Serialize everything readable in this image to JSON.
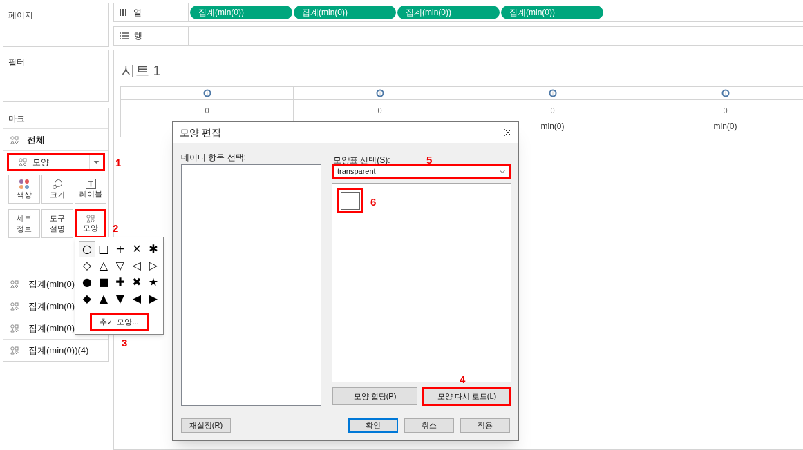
{
  "pages_card": {
    "title": "페이지"
  },
  "filters_card": {
    "title": "필터"
  },
  "marks": {
    "title": "마크",
    "all_label": "전체",
    "mark_type": {
      "value": "모양",
      "highlighted": true,
      "callout": "1"
    },
    "properties": [
      {
        "lines": [
          "색상"
        ],
        "kind": "color",
        "highlighted": false
      },
      {
        "lines": [
          "크기"
        ],
        "kind": "size",
        "highlighted": false
      },
      {
        "lines": [
          "레이블"
        ],
        "kind": "label",
        "highlighted": false
      },
      {
        "lines": [
          "세부",
          "정보"
        ],
        "kind": "text",
        "highlighted": false
      },
      {
        "lines": [
          "도구",
          "설명"
        ],
        "kind": "text",
        "highlighted": false
      },
      {
        "lines": [
          "모양"
        ],
        "kind": "shape",
        "highlighted": true,
        "callout": "2"
      }
    ],
    "layers": [
      {
        "label": "집계(min(0)"
      },
      {
        "label": "집계(min(0)"
      },
      {
        "label": "집계(min(0)"
      },
      {
        "label": "집계(min(0))(4)"
      }
    ]
  },
  "shelves": [
    {
      "label": "열",
      "kind": "columns",
      "pills": [
        "집계(min(0))",
        "집계(min(0))",
        "집계(min(0))",
        "집계(min(0))"
      ]
    },
    {
      "label": "행",
      "kind": "rows"
    }
  ],
  "sheet": {
    "title": "시트 1",
    "columns": [
      {
        "axis_value": "0"
      },
      {
        "axis_value": "0"
      },
      {
        "axis_value": "0",
        "field_label": "min(0)"
      },
      {
        "axis_value": "0",
        "field_label": "min(0)"
      }
    ]
  },
  "shape_menu": {
    "shapes": [
      {
        "symbol": "○",
        "selected": true
      },
      {
        "symbol": "□",
        "selected": false
      },
      {
        "symbol": "+",
        "selected": false
      },
      {
        "symbol": "✕",
        "selected": false
      },
      {
        "symbol": "✱",
        "selected": false
      },
      {
        "symbol": "◇",
        "selected": false
      },
      {
        "symbol": "△",
        "selected": false
      },
      {
        "symbol": "▽",
        "selected": false
      },
      {
        "symbol": "◁",
        "selected": false
      },
      {
        "symbol": "▷",
        "selected": false
      },
      {
        "symbol": "●",
        "selected": false
      },
      {
        "symbol": "■",
        "selected": false
      },
      {
        "symbol": "✚",
        "selected": false
      },
      {
        "symbol": "✖",
        "selected": false
      },
      {
        "symbol": "★",
        "selected": false
      },
      {
        "symbol": "◆",
        "selected": false
      },
      {
        "symbol": "▲",
        "selected": false
      },
      {
        "symbol": "▼",
        "selected": false
      },
      {
        "symbol": "◀",
        "selected": false
      },
      {
        "symbol": "▶",
        "selected": false
      }
    ],
    "more_button": {
      "label": "추가 모양...",
      "highlighted": true,
      "callout": "3"
    }
  },
  "dialog": {
    "title": "모양 편집",
    "data_label": "데이터 항목 선택:",
    "palette_label": "모양표 선택(S):",
    "palette": {
      "value": "transparent",
      "highlighted": true,
      "callout": "5"
    },
    "palette_shapes": [
      {
        "highlighted": true,
        "callout": "6"
      }
    ],
    "assign_button": {
      "label": "모양 할당(P)",
      "highlighted": false
    },
    "reload_button": {
      "label": "모양 다시 로드(L)",
      "highlighted": true,
      "callout": "4"
    },
    "buttons": [
      {
        "label": "재설정(R)",
        "default": false
      },
      {
        "label": "확인",
        "default": true
      },
      {
        "label": "취소",
        "default": false
      },
      {
        "label": "적용",
        "default": false
      }
    ]
  }
}
